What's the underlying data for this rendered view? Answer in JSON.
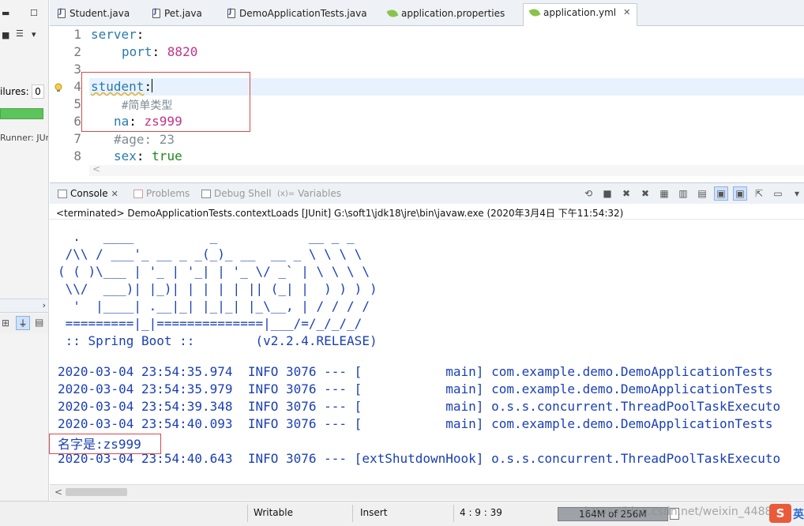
{
  "left_panel": {
    "failures_label": "ilures:",
    "failures_count": "0",
    "runner_label": "Runner: JUr",
    "bar_color": "#5bc45a"
  },
  "tabs": [
    {
      "label": "Student.java",
      "icon": "java-file-icon",
      "active": false
    },
    {
      "label": "Pet.java",
      "icon": "java-file-icon",
      "active": false
    },
    {
      "label": "DemoApplicationTests.java",
      "icon": "java-file-icon",
      "active": false
    },
    {
      "label": "application.properties",
      "icon": "properties-file-icon",
      "active": false
    },
    {
      "label": "application.yml",
      "icon": "yml-file-icon",
      "active": true,
      "close": "✕"
    }
  ],
  "editor": {
    "line_numbers": [
      "1",
      "2",
      "3",
      "4",
      "5",
      "6",
      "7",
      "8"
    ],
    "lines": {
      "l1_key": "server",
      "l1_colon": ":",
      "l2_key": "port",
      "l2_colon": ": ",
      "l2_val": "8820",
      "l4_key": "student",
      "l4_colon": ":",
      "l5_comment": "#简单类型",
      "l6_key": "na",
      "l6_colon": ": ",
      "l6_val": "zs999",
      "l7_comment": "#age: 23",
      "l8_key": "sex",
      "l8_colon": ": ",
      "l8_val": "true"
    },
    "scroll_arrow": "<"
  },
  "console": {
    "tabs": {
      "console": "Console",
      "problems": "Problems",
      "debug_shell": "Debug Shell",
      "variables": "Variables",
      "variables_prefix": "(x)="
    },
    "close_glyph": "✕",
    "header": "<terminated> DemoApplicationTests.contextLoads [JUnit] G:\\soft1\\jdk18\\jre\\bin\\javaw.exe (2020年3月4日 下午11:54:32)",
    "banner": "  .   ____          _            __ _ _\n /\\\\ / ___'_ __ _ _(_)_ __  __ _ \\ \\ \\ \\\n( ( )\\___ | '_ | '_| | '_ \\/ _` | \\ \\ \\ \\\n \\\\/  ___)| |_)| | | | | || (_| |  ) ) ) )\n  '  |____| .__|_| |_|_| |_\\__, | / / / /\n =========|_|==============|___/=/_/_/_/\n :: Spring Boot ::        (v2.2.4.RELEASE)",
    "log_lines": [
      "2020-03-04 23:54:35.974  INFO 3076 --- [           main] com.example.demo.DemoApplicationTests",
      "2020-03-04 23:54:35.979  INFO 3076 --- [           main] com.example.demo.DemoApplicationTests",
      "2020-03-04 23:54:39.348  INFO 3076 --- [           main] o.s.s.concurrent.ThreadPoolTaskExecuto",
      "2020-03-04 23:54:40.093  INFO 3076 --- [           main] com.example.demo.DemoApplicationTests"
    ],
    "name_line": "名字是:zs999",
    "last_line": "2020-03-04 23:54:40.643  INFO 3076 --- [extShutdownHook] o.s.s.concurrent.ThreadPoolTaskExecuto",
    "hscroll_arrow": "<"
  },
  "status_bar": {
    "writable": "Writable",
    "insert": "Insert",
    "position": "4 : 9 : 39",
    "heap": "164M of 256M",
    "watermark": "https://blog.csdn.net/weixin_4488",
    "ime_label": "S",
    "ime_lang": "英"
  },
  "colors": {
    "yaml_key": "#2a7ab0",
    "yaml_value": "#c0348a",
    "yaml_bool": "#1d8a1d",
    "console_text": "#1a3fb8",
    "highlight_box": "#d84a4a",
    "current_line": "#e8f2fe"
  }
}
